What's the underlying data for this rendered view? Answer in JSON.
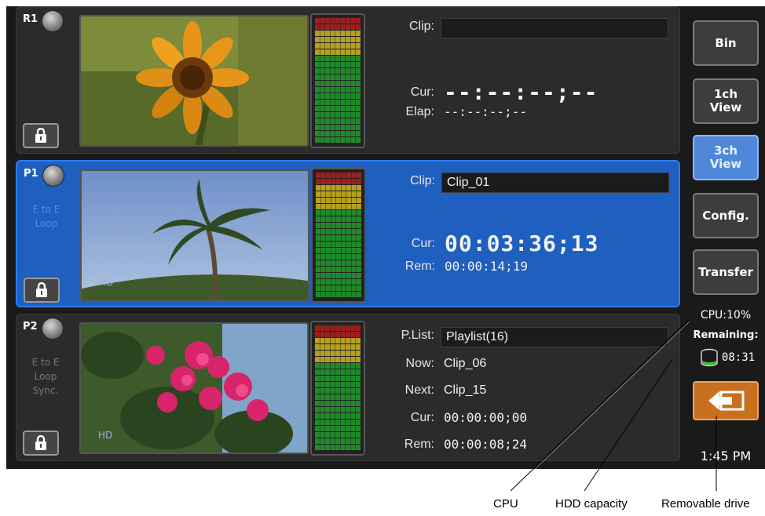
{
  "channels": [
    {
      "id": "R1",
      "mode": "",
      "info": {
        "rows": [
          {
            "label": "Clip:",
            "value": ""
          },
          {
            "label": "Cur:",
            "value": "--:--:--;--"
          },
          {
            "label": "Elap:",
            "value": "--:--:--;--"
          }
        ]
      }
    },
    {
      "id": "P1",
      "mode": "E to E\nLoop",
      "info": {
        "rows": [
          {
            "label": "Clip:",
            "value": "Clip_01"
          },
          {
            "label": "Cur:",
            "value": "00:03:36;13"
          },
          {
            "label": "Rem:",
            "value": "00:00:14;19"
          }
        ]
      }
    },
    {
      "id": "P2",
      "mode": "E to E\nLoop\nSync.",
      "info": {
        "rows": [
          {
            "label": "P.List:",
            "value": "Playlist(16)"
          },
          {
            "label": "Now:",
            "value": "Clip_06"
          },
          {
            "label": "Next:",
            "value": "Clip_15"
          },
          {
            "label": "Cur:",
            "value": "00:00:00;00"
          },
          {
            "label": "Rem:",
            "value": "00:00:08;24"
          }
        ]
      }
    }
  ],
  "sidebar": {
    "buttons": [
      {
        "label": "Bin"
      },
      {
        "label": "1ch\nView"
      },
      {
        "label": "3ch\nView"
      },
      {
        "label": "Config."
      },
      {
        "label": "Transfer"
      }
    ],
    "cpu": "CPU:10%",
    "remaining_label": "Remaining:",
    "remaining_time": "08:31",
    "clock": "1:45 PM"
  },
  "callouts": {
    "cpu": "CPU",
    "hdd": "HDD capacity",
    "drive": "Removable drive"
  },
  "colors": {
    "active_channel": "#1e5fbf",
    "selected_button": "#4f88d9",
    "drive_button": "#c9701e"
  }
}
